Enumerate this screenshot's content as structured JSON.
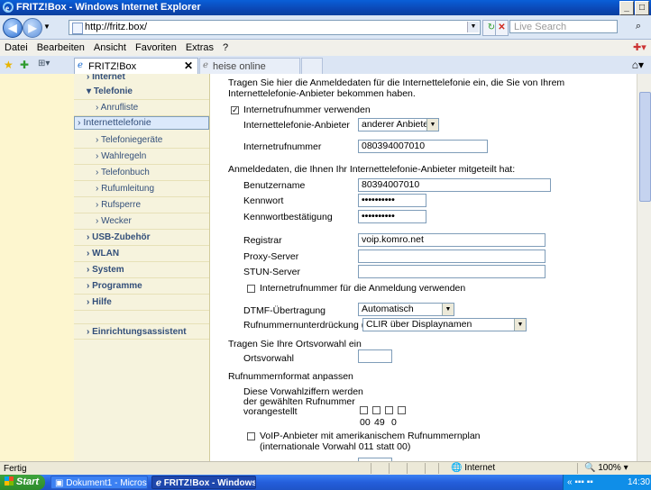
{
  "window": {
    "title": "FRITZ!Box - Windows Internet Explorer"
  },
  "address": {
    "url": "http://fritz.box/",
    "search_placeholder": "Live Search"
  },
  "menu": [
    "Datei",
    "Bearbeiten",
    "Ansicht",
    "Favoriten",
    "Extras",
    "?"
  ],
  "tabs": [
    {
      "label": "FRITZ!Box"
    },
    {
      "label": "heise online"
    }
  ],
  "nav": {
    "internet": "Internet",
    "telefonie": "Telefonie",
    "anrufliste": "Anrufliste",
    "internettelefonie": "Internettelefonie",
    "telefoniegeraete": "Telefoniegeräte",
    "wahlregeln": "Wahlregeln",
    "telefonbuch": "Telefonbuch",
    "rufumleitung": "Rufumleitung",
    "rufsperre": "Rufsperre",
    "wecker": "Wecker",
    "usb": "USB-Zubehör",
    "wlan": "WLAN",
    "system": "System",
    "programme": "Programme",
    "hilfe": "Hilfe",
    "assistent": "Einrichtungsassistent"
  },
  "form": {
    "intro_1": "Tragen Sie hier die Anmeldedaten für die Internettelefonie ein, die Sie von Ihrem",
    "intro_2": "Internettelefonie-Anbieter bekommen haben.",
    "use_number_label": "Internetrufnummer verwenden",
    "use_number_checked": true,
    "provider_label": "Internettelefonie-Anbieter",
    "provider_value": "anderer Anbieter",
    "number_label": "Internetrufnummer",
    "number_value": "080394007010",
    "login_intro": "Anmeldedaten, die Ihnen Ihr Internettelefonie-Anbieter mitgeteilt hat:",
    "username_label": "Benutzername",
    "username_value": "80394007010",
    "password_label": "Kennwort",
    "password_value": "••••••••••",
    "password_confirm_label": "Kennwortbestätigung",
    "password_confirm_value": "••••••••••",
    "registrar_label": "Registrar",
    "registrar_value": "voip.komro.net",
    "proxy_label": "Proxy-Server",
    "proxy_value": "",
    "stun_label": "STUN-Server",
    "stun_value": "",
    "use_for_login_label": "Internetrufnummer für die Anmeldung verwenden",
    "dtmf_label": "DTMF-Übertragung",
    "dtmf_value": "Automatisch",
    "clir_label": "Rufnummernunterdrückung (CLIR)",
    "clir_value": "CLIR über Displaynamen",
    "area_intro": "Tragen Sie Ihre Ortsvorwahl ein",
    "area_label": "Ortsvorwahl",
    "area_value": "",
    "format_heading": "Rufnummernformat anpassen",
    "prefix_text_1": "Diese Vorwahlziffern werden",
    "prefix_text_2": "der gewählten Rufnummer",
    "prefix_text_3": "vorangestellt",
    "prefix_1": "00",
    "prefix_2": "49",
    "prefix_3": "0",
    "us_plan_1": "VoIP-Anbieter mit amerikanischem Rufnummernplan",
    "us_plan_2": "(internationale Vorwahl 011 statt 00)"
  },
  "status": {
    "text": "Fertig",
    "zone": "Internet",
    "zoom": "100%"
  },
  "taskbar": {
    "start": "Start",
    "tasks": [
      "Dokument1 - Microsoft ...",
      "FRITZ!Box - Windows ..."
    ],
    "clock": "14:30"
  }
}
